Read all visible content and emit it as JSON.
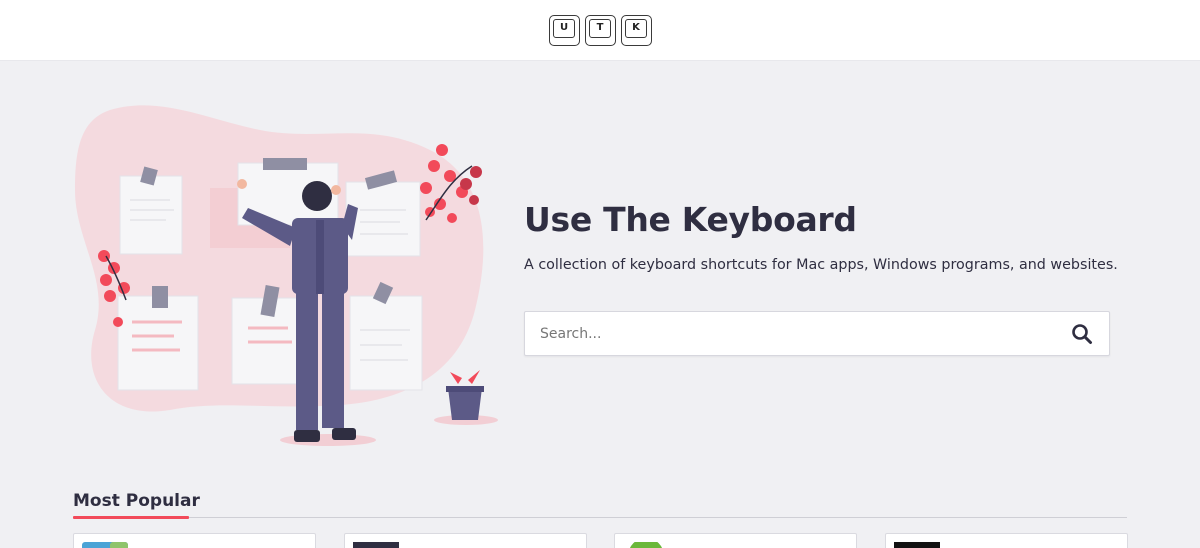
{
  "header": {
    "logo_keys": [
      "U",
      "T",
      "K"
    ]
  },
  "hero": {
    "title": "Use The Keyboard",
    "subtitle": "A collection of keyboard shortcuts for Mac apps, Windows programs, and websites.",
    "illustration": "person-with-sticky-notes-illustration"
  },
  "search": {
    "placeholder": "Search...",
    "value": "",
    "button_icon": "search-icon"
  },
  "popular": {
    "title": "Most Popular",
    "accent_color": "#f24a5a",
    "cards": [
      {
        "icon": "app-thumbnail-blue-green"
      },
      {
        "icon": "app-thumbnail-dark"
      },
      {
        "icon": "app-thumbnail-green-circle"
      },
      {
        "icon": "app-thumbnail-black"
      }
    ]
  },
  "colors": {
    "background": "#f0f0f3",
    "header_bg": "#ffffff",
    "text": "#2f2e41",
    "accent": "#f24a5a"
  }
}
